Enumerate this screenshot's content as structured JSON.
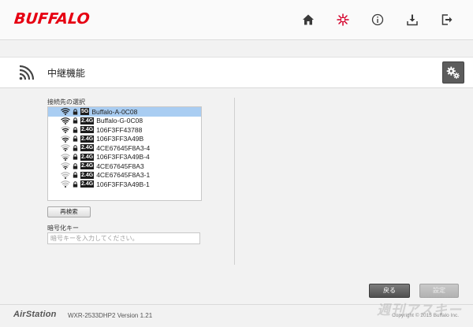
{
  "header": {
    "logo": "BUFFALO",
    "nav": [
      {
        "icon": "home-icon"
      },
      {
        "icon": "wireless-status-icon"
      },
      {
        "icon": "info-icon"
      },
      {
        "icon": "download-icon"
      },
      {
        "icon": "logout-icon"
      }
    ]
  },
  "page": {
    "title": "中継機能",
    "title_icon": "wifi-signal-icon",
    "settings_icon": "gears-icon"
  },
  "form": {
    "connection_label": "接続先の選択",
    "networks": [
      {
        "band": "5G",
        "ssid": "Buffalo-A-0C08",
        "selected": true,
        "signal": 4
      },
      {
        "band": "2.4G",
        "ssid": "Buffalo-G-0C08",
        "selected": false,
        "signal": 4
      },
      {
        "band": "2.4G",
        "ssid": "106F3FF43788",
        "selected": false,
        "signal": 3
      },
      {
        "band": "2.4G",
        "ssid": "106F3FF3A49B",
        "selected": false,
        "signal": 3
      },
      {
        "band": "2.4G",
        "ssid": "4CE67645F8A3-4",
        "selected": false,
        "signal": 2
      },
      {
        "band": "2.4G",
        "ssid": "106F3FF3A49B-4",
        "selected": false,
        "signal": 2
      },
      {
        "band": "2.4G",
        "ssid": "4CE67645F8A3",
        "selected": false,
        "signal": 2
      },
      {
        "band": "2.4G",
        "ssid": "4CE67645F8A3-1",
        "selected": false,
        "signal": 1
      },
      {
        "band": "2.4G",
        "ssid": "106F3FF3A49B-1",
        "selected": false,
        "signal": 1
      }
    ],
    "rescan_label": "再検索",
    "key_label": "暗号化キー",
    "key_placeholder": "暗号キーを入力してください。"
  },
  "actions": {
    "back_label": "戻る",
    "apply_label": "設定"
  },
  "footer": {
    "product": "AirStation",
    "model": "WXR-2533DHP2   Version 1.21",
    "copyright": "Copyright © 2015 Buffalo Inc."
  },
  "watermark": "週刊アスキー",
  "colors": {
    "brand": "#e60012",
    "selection": "#a9cdf2",
    "button_dark": "#5c5c5c"
  }
}
